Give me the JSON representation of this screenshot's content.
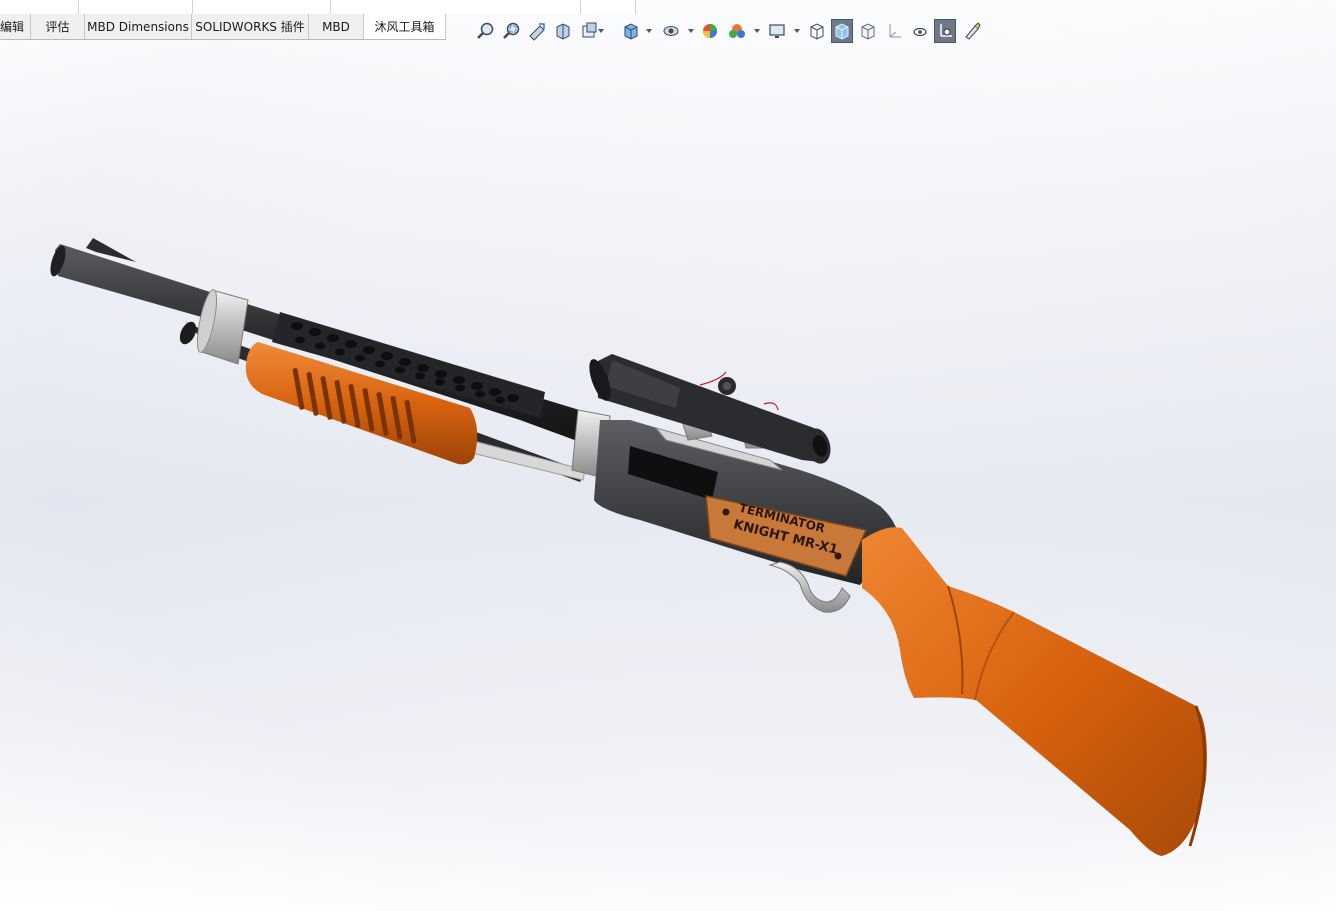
{
  "command_manager": {
    "tabs": [
      {
        "label": "编辑",
        "active": false
      },
      {
        "label": "评估",
        "active": false
      },
      {
        "label": "MBD Dimensions",
        "active": false
      },
      {
        "label": "SOLIDWORKS 插件",
        "active": false
      },
      {
        "label": "MBD",
        "active": false
      },
      {
        "label": "沐风工具箱",
        "active": true
      }
    ]
  },
  "view_toolbar": {
    "buttons": [
      {
        "icon": "zoom-to-fit-icon"
      },
      {
        "icon": "zoom-to-area-icon"
      },
      {
        "icon": "previous-view-icon"
      },
      {
        "icon": "section-view-icon"
      },
      {
        "icon": "dynamic-annotation-icon",
        "dropdown": true
      },
      {
        "icon": "view-orientation-icon",
        "dropdown": true
      },
      {
        "icon": "display-style-icon",
        "dropdown": true
      },
      {
        "icon": "edit-appearance-icon"
      },
      {
        "icon": "apply-scene-icon",
        "dropdown": true
      },
      {
        "icon": "view-settings-icon",
        "dropdown": true
      },
      {
        "icon": "wireframe-icon"
      },
      {
        "icon": "shaded-icon",
        "active": true
      },
      {
        "icon": "hidden-lines-icon"
      },
      {
        "icon": "view-axes-icon"
      },
      {
        "icon": "hide-show-items-icon"
      },
      {
        "icon": "view-sketch-icon",
        "active": true
      },
      {
        "icon": "rendering-tools-icon"
      }
    ]
  },
  "model": {
    "plate_line1": "TERMINATOR",
    "plate_line2": "KNIGHT MR-X1",
    "colors": {
      "stock": "#d9650f",
      "stock_dark": "#8a3a05",
      "metal_dark": "#2c2d30",
      "metal_mid": "#505257",
      "steel": "#c8c8c8",
      "plate": "#c87a3c"
    }
  }
}
